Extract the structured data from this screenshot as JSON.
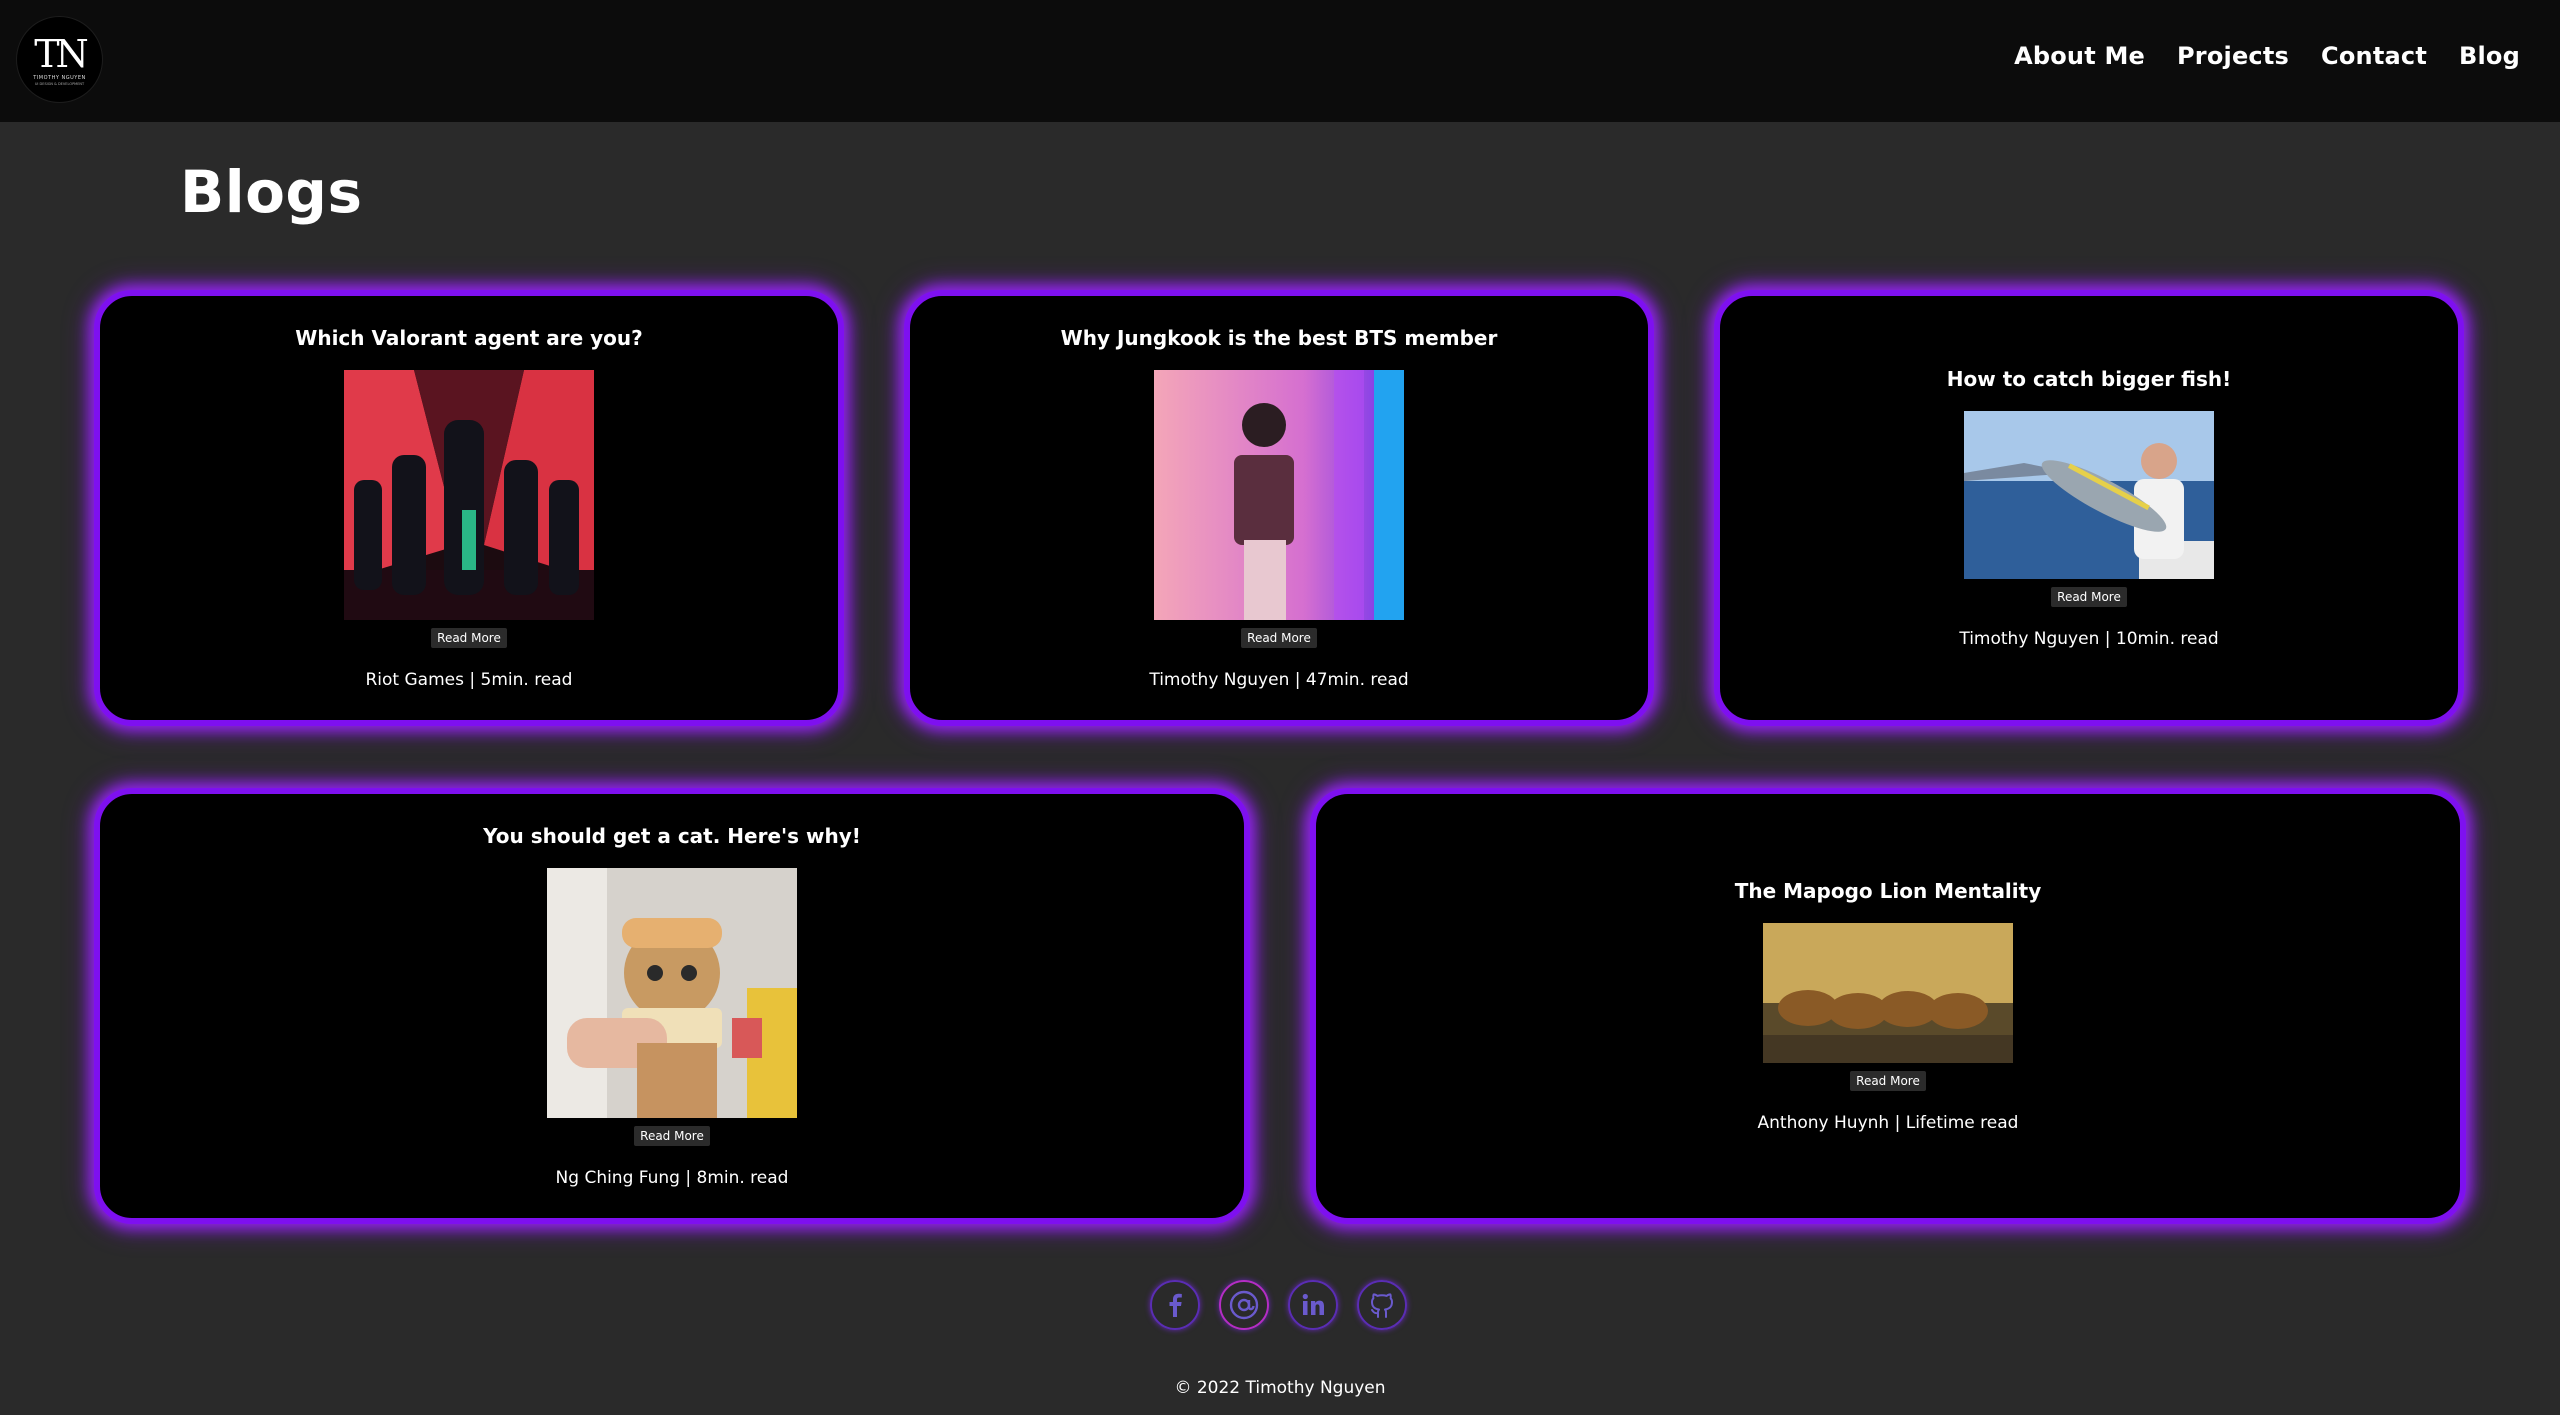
{
  "nav": {
    "logo": {
      "mono": "TN",
      "name": "TIMOTHY NGUYEN",
      "sub": "UI DESIGN & DEVELOPMENT"
    },
    "links": [
      "About Me",
      "Projects",
      "Contact",
      "Blog"
    ]
  },
  "page": {
    "title": "Blogs"
  },
  "blogs": [
    {
      "title": "Which Valorant agent are you?",
      "button": "Read More",
      "meta": "Riot Games | 5min. read"
    },
    {
      "title": "Why Jungkook is the best BTS member",
      "button": "Read More",
      "meta": "Timothy Nguyen | 47min. read"
    },
    {
      "title": "How to catch bigger fish!",
      "button": "Read More",
      "meta": "Timothy Nguyen | 10min. read"
    },
    {
      "title": "You should get a cat. Here's why!",
      "button": "Read More",
      "meta": "Ng Ching Fung | 8min. read"
    },
    {
      "title": "The Mapogo Lion Mentality",
      "button": "Read More",
      "meta": "Anthony Huynh | Lifetime read"
    }
  ],
  "socials": [
    {
      "icon": "facebook-icon"
    },
    {
      "icon": "email-icon"
    },
    {
      "icon": "linkedin-icon"
    },
    {
      "icon": "github-icon"
    }
  ],
  "footer": {
    "copyright": "© 2022 Timothy Nguyen"
  },
  "colors": {
    "accent": "#7e10f0",
    "glow": "#9d26ff",
    "background": "#2a2a2a",
    "navbar": "#0c0c0c"
  }
}
